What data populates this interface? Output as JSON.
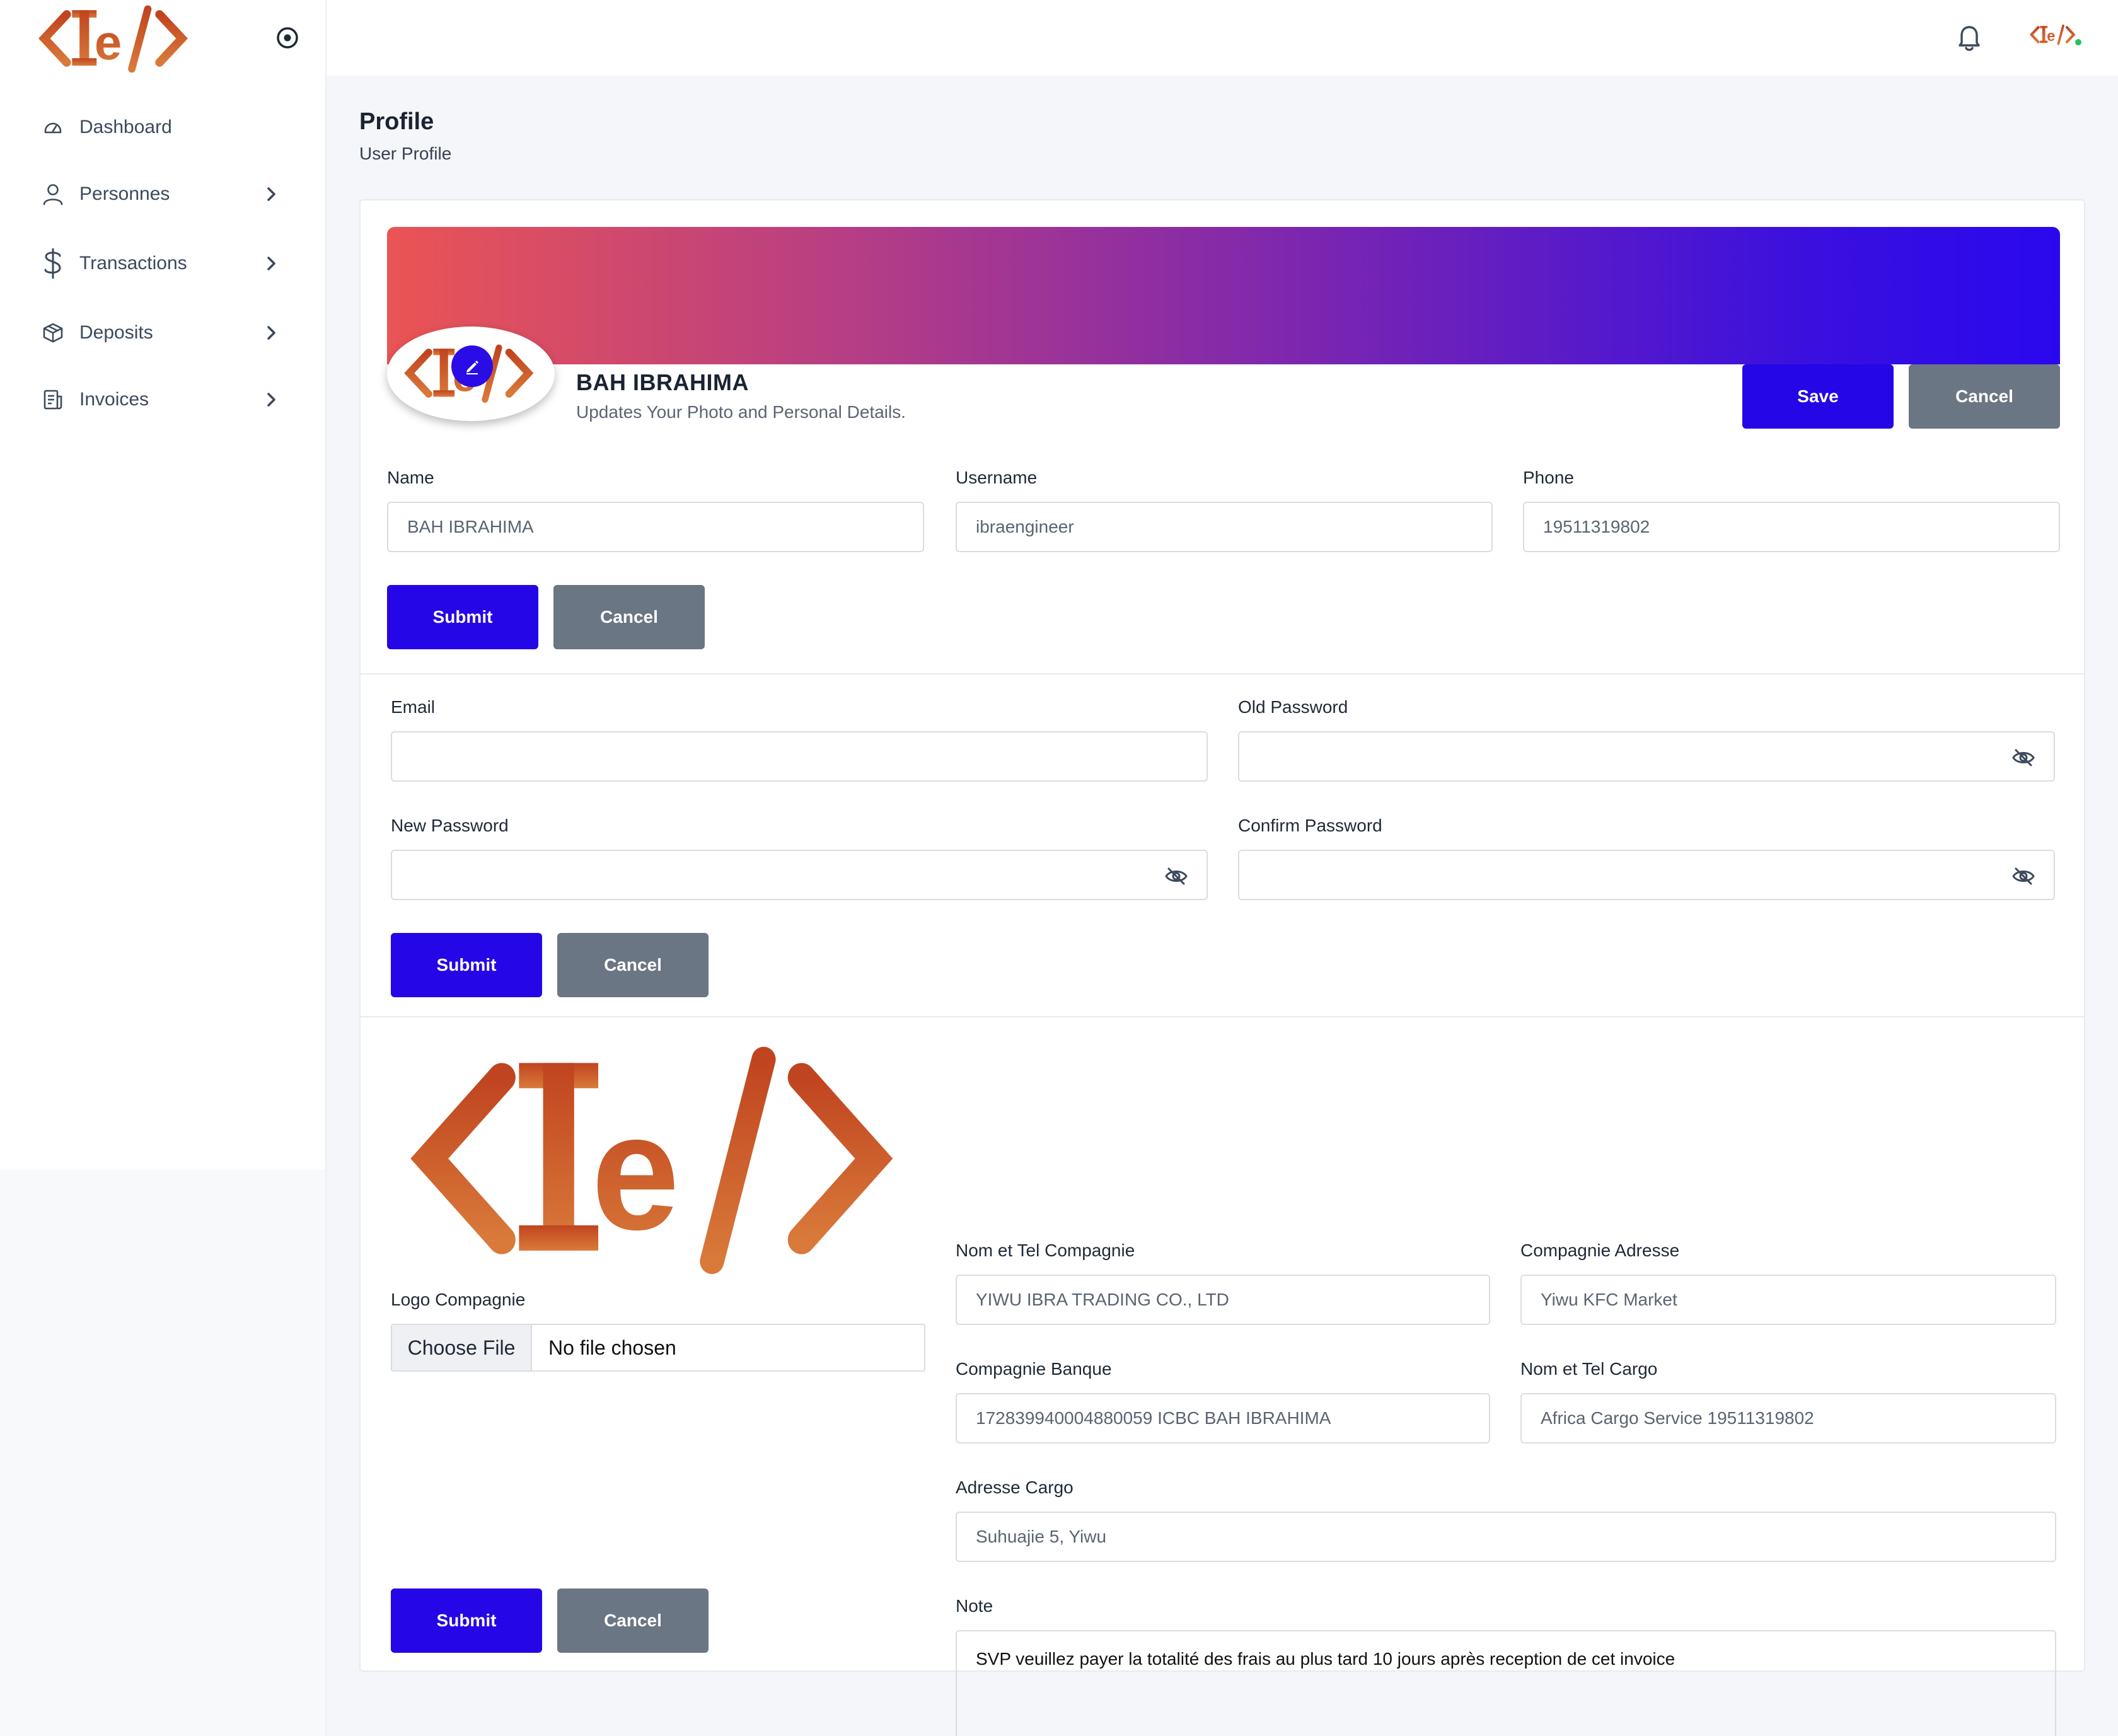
{
  "sidebar": {
    "items": [
      {
        "label": "Dashboard"
      },
      {
        "label": "Personnes"
      },
      {
        "label": "Transactions"
      },
      {
        "label": "Deposits"
      },
      {
        "label": "Invoices"
      }
    ]
  },
  "header": {
    "title": "Profile",
    "subtitle": "User Profile"
  },
  "profile": {
    "name": "BAH IBRAHIMA",
    "description": "Updates Your Photo and Personal Details.",
    "save_label": "Save",
    "cancel_label": "Cancel"
  },
  "account_form": {
    "name_label": "Name",
    "name_value": "BAH IBRAHIMA",
    "username_label": "Username",
    "username_value": "ibraengineer",
    "phone_label": "Phone",
    "phone_value": "19511319802",
    "submit_label": "Submit",
    "cancel_label": "Cancel"
  },
  "password_form": {
    "email_label": "Email",
    "email_value": "",
    "old_password_label": "Old Password",
    "new_password_label": "New Password",
    "confirm_password_label": "Confirm Password",
    "submit_label": "Submit",
    "cancel_label": "Cancel"
  },
  "company_form": {
    "logo_label": "Logo Compagnie",
    "file_button_label": "Choose File",
    "file_status": "No file chosen",
    "company_name_label": "Nom et Tel Compagnie",
    "company_name_value": "YIWU IBRA TRADING CO., LTD",
    "company_address_label": "Compagnie Adresse",
    "company_address_value": "Yiwu KFC Market",
    "company_bank_label": "Compagnie Banque",
    "company_bank_value": "172839940004880059 ICBC BAH IBRAHIMA",
    "cargo_name_label": "Nom et Tel Cargo",
    "cargo_name_value": "Africa Cargo Service 19511319802",
    "cargo_address_label": "Adresse Cargo",
    "cargo_address_value": "Suhuajie 5, Yiwu",
    "note_label": "Note",
    "note_value": "SVP veuillez payer la totalité des frais au plus tard 10 jours après reception de cet invoice",
    "submit_label": "Submit",
    "cancel_label": "Cancel"
  },
  "colors": {
    "primary": "#2406e6",
    "secondary": "#6b7684",
    "logo_gradient_start": "#c0441f",
    "logo_gradient_end": "#d97a3a",
    "banner_start": "#ea5454",
    "banner_end": "#2a08ee",
    "online_dot": "#22c55e"
  },
  "icons": {
    "sidebar_toggle": "target-icon",
    "dashboard": "gauge-icon",
    "personnes": "user-icon",
    "transactions": "dollar-icon",
    "deposits": "box-icon",
    "invoices": "invoice-icon",
    "notifications": "bell-icon",
    "password_visibility": "eye-off-icon",
    "edit": "pencil-icon"
  }
}
